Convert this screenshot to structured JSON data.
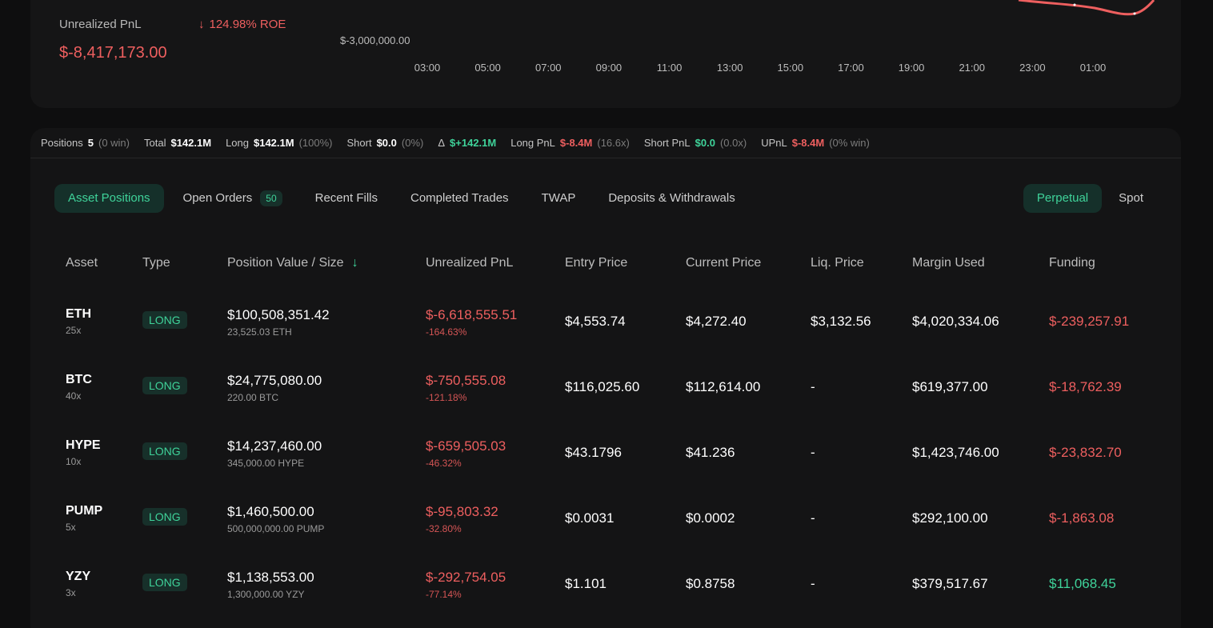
{
  "summary": {
    "upnl_label": "Unrealized PnL",
    "roe": "124.98% ROE",
    "upnl_value": "$-8,417,173.00"
  },
  "chart_data": {
    "type": "line",
    "y_ticks": [
      "$-3,000,000.00"
    ],
    "x_ticks": [
      "03:00",
      "05:00",
      "07:00",
      "09:00",
      "11:00",
      "13:00",
      "15:00",
      "17:00",
      "19:00",
      "21:00",
      "23:00",
      "01:00"
    ],
    "line_color": "#ee5f5f"
  },
  "stats": [
    {
      "label": "Positions",
      "value": "5",
      "sub": "(0 win)",
      "tone": "white"
    },
    {
      "label": "Total",
      "value": "$142.1M",
      "sub": "",
      "tone": "white"
    },
    {
      "label": "Long",
      "value": "$142.1M",
      "sub": "(100%)",
      "tone": "white"
    },
    {
      "label": "Short",
      "value": "$0.0",
      "sub": "(0%)",
      "tone": "white"
    },
    {
      "label": "Δ",
      "value": "$+142.1M",
      "sub": "",
      "tone": "green"
    },
    {
      "label": "Long PnL",
      "value": "$-8.4M",
      "sub": "(16.6x)",
      "tone": "red"
    },
    {
      "label": "Short PnL",
      "value": "$0.0",
      "sub": "(0.0x)",
      "tone": "green"
    },
    {
      "label": "UPnL",
      "value": "$-8.4M",
      "sub": "(0% win)",
      "tone": "red"
    }
  ],
  "tabs": [
    {
      "label": "Asset Positions",
      "active": true,
      "badge": ""
    },
    {
      "label": "Open Orders",
      "active": false,
      "badge": "50"
    },
    {
      "label": "Recent Fills",
      "active": false,
      "badge": ""
    },
    {
      "label": "Completed Trades",
      "active": false,
      "badge": ""
    },
    {
      "label": "TWAP",
      "active": false,
      "badge": ""
    },
    {
      "label": "Deposits & Withdrawals",
      "active": false,
      "badge": ""
    }
  ],
  "market_tabs": [
    {
      "label": "Perpetual",
      "active": true
    },
    {
      "label": "Spot",
      "active": false
    }
  ],
  "table": {
    "headers": {
      "asset": "Asset",
      "type": "Type",
      "position": "Position Value / Size",
      "upnl": "Unrealized PnL",
      "entry": "Entry Price",
      "current": "Current Price",
      "liq": "Liq. Price",
      "margin": "Margin Used",
      "funding": "Funding"
    },
    "rows": [
      {
        "asset": "ETH",
        "leverage": "25x",
        "type": "LONG",
        "value": "$100,508,351.42",
        "size": "23,525.03 ETH",
        "upnl": "$-6,618,555.51",
        "upnl_pct": "-164.63%",
        "entry": "$4,553.74",
        "current": "$4,272.40",
        "liq": "$3,132.56",
        "margin": "$4,020,334.06",
        "funding": "$-239,257.91",
        "funding_tone": "red"
      },
      {
        "asset": "BTC",
        "leverage": "40x",
        "type": "LONG",
        "value": "$24,775,080.00",
        "size": "220.00 BTC",
        "upnl": "$-750,555.08",
        "upnl_pct": "-121.18%",
        "entry": "$116,025.60",
        "current": "$112,614.00",
        "liq": "-",
        "margin": "$619,377.00",
        "funding": "$-18,762.39",
        "funding_tone": "red"
      },
      {
        "asset": "HYPE",
        "leverage": "10x",
        "type": "LONG",
        "value": "$14,237,460.00",
        "size": "345,000.00 HYPE",
        "upnl": "$-659,505.03",
        "upnl_pct": "-46.32%",
        "entry": "$43.1796",
        "current": "$41.236",
        "liq": "-",
        "margin": "$1,423,746.00",
        "funding": "$-23,832.70",
        "funding_tone": "red"
      },
      {
        "asset": "PUMP",
        "leverage": "5x",
        "type": "LONG",
        "value": "$1,460,500.00",
        "size": "500,000,000.00 PUMP",
        "upnl": "$-95,803.32",
        "upnl_pct": "-32.80%",
        "entry": "$0.0031",
        "current": "$0.0002",
        "liq": "-",
        "margin": "$292,100.00",
        "funding": "$-1,863.08",
        "funding_tone": "red"
      },
      {
        "asset": "YZY",
        "leverage": "3x",
        "type": "LONG",
        "value": "$1,138,553.00",
        "size": "1,300,000.00 YZY",
        "upnl": "$-292,754.05",
        "upnl_pct": "-77.14%",
        "entry": "$1.101",
        "current": "$0.8758",
        "liq": "-",
        "margin": "$379,517.67",
        "funding": "$11,068.45",
        "funding_tone": "green"
      }
    ]
  }
}
